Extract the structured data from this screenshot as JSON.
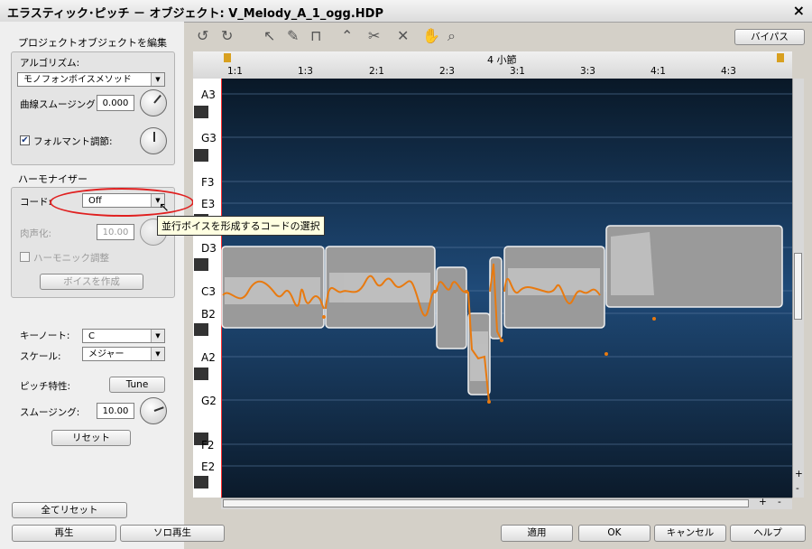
{
  "window": {
    "title": "エラスティック･ピッチ － オブジェクト: V_Melody_A_1_ogg.HDP",
    "close": "×"
  },
  "left_panel": {
    "section_title": "プロジェクトオブジェクトを編集",
    "algorithm": {
      "label": "アルゴリズム:",
      "value": "モノフォンボイスメソッド"
    },
    "smoothing": {
      "label": "曲線スムージング:",
      "value": "0.000"
    },
    "formant": {
      "label": "フォルマント調節:",
      "checked": true,
      "check_mark": "✔"
    },
    "harmonizer": {
      "title": "ハーモナイザー",
      "chord_label": "コード:",
      "chord_value": "Off",
      "humanize_label": "肉声化:",
      "humanize_value": "10.00",
      "harmonic_label": "ハーモニック調整",
      "create_voice": "ボイスを作成"
    },
    "key_note": {
      "label": "キーノート:",
      "value": "C"
    },
    "scale": {
      "label": "スケール:",
      "value": "メジャー"
    },
    "pitch_char": {
      "label": "ピッチ特性:",
      "button": "Tune"
    },
    "smoothing2": {
      "label": "スムージング:",
      "value": "10.00"
    },
    "reset_button": "リセット",
    "reset_all_button": "全てリセット"
  },
  "toolbar": {
    "icons": [
      "undo-icon",
      "redo-icon",
      "pointer-icon",
      "pencil-icon",
      "pulse-icon",
      "curve-icon",
      "scissors-icon",
      "delete-icon",
      "hand-icon",
      "zoom-icon"
    ],
    "bypass_button": "バイパス"
  },
  "tooltip": "並行ボイスを形成するコードの選択",
  "timeline": {
    "measure_label": "4 小節",
    "ticks": [
      "1:1",
      "1:3",
      "2:1",
      "2:3",
      "3:1",
      "3:3",
      "4:1",
      "4:3"
    ]
  },
  "piano": {
    "notes": [
      "A3",
      "G3",
      "F3",
      "E3",
      "D3",
      "C3",
      "B2",
      "A2",
      "G2",
      "F2",
      "E2"
    ]
  },
  "zoom": {
    "plus": "+",
    "minus": "-"
  },
  "footer": {
    "play": "再生",
    "solo_play": "ソロ再生",
    "apply": "適用",
    "ok": "OK",
    "cancel": "キャンセル",
    "help": "ヘルプ"
  },
  "colors": {
    "accent": "#e87a10",
    "annotation": "#e02020"
  }
}
